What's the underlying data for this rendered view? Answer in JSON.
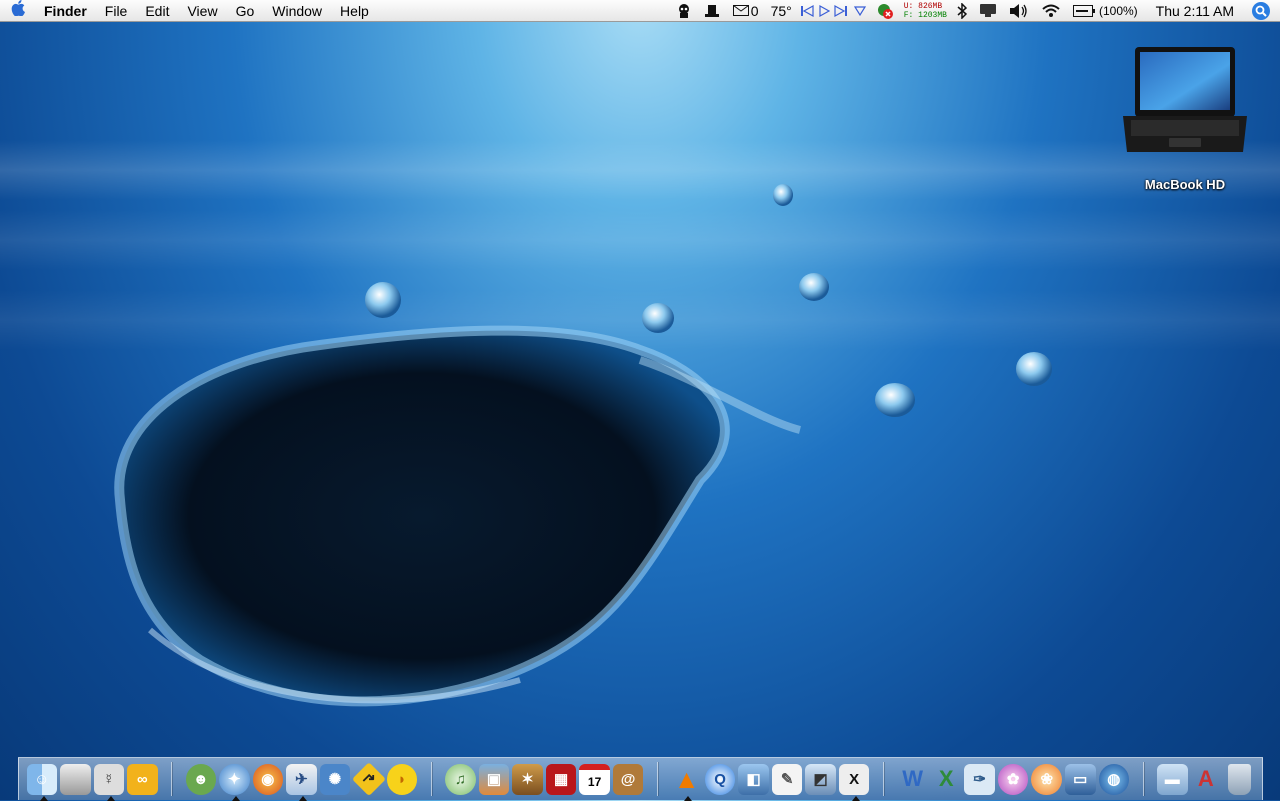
{
  "menubar": {
    "app_name": "Finder",
    "menus": [
      "File",
      "Edit",
      "View",
      "Go",
      "Window",
      "Help"
    ],
    "mail_count": "0",
    "temperature": "75°",
    "memory_used": "U: 826MB",
    "memory_free": "F: 1203MB",
    "battery": "(100%)",
    "clock": "Thu 2:11 AM"
  },
  "desktop": {
    "icons": [
      {
        "label": "MacBook HD",
        "icon": "laptop-icon"
      }
    ]
  },
  "dock": {
    "groups": [
      [
        "finder",
        "apple-app",
        "adium",
        "app-4"
      ],
      [
        "adium-duck",
        "safari",
        "firefox",
        "mail",
        "app-blue",
        "caution-app",
        "duck-app"
      ],
      [
        "itunes",
        "iphoto",
        "imovie",
        "photo-booth",
        "ical",
        "address-book"
      ],
      [
        "vlc",
        "quicktime",
        "screen-sharing",
        "textedit",
        "preview",
        "x11"
      ],
      [
        "word",
        "excel",
        "comic-app",
        "pinwheel-app",
        "flower-app",
        "keynote",
        "google-earth"
      ],
      [
        "folder",
        "applications",
        "trash"
      ]
    ],
    "running": [
      "finder",
      "adium",
      "safari",
      "mail",
      "vlc",
      "x11"
    ]
  },
  "colors": {
    "accent": "#2a6bd4",
    "desktop_top": "#a8dcf5",
    "desktop_bottom": "#083a7a",
    "memory_used": "#b00000",
    "memory_free": "#008000"
  }
}
